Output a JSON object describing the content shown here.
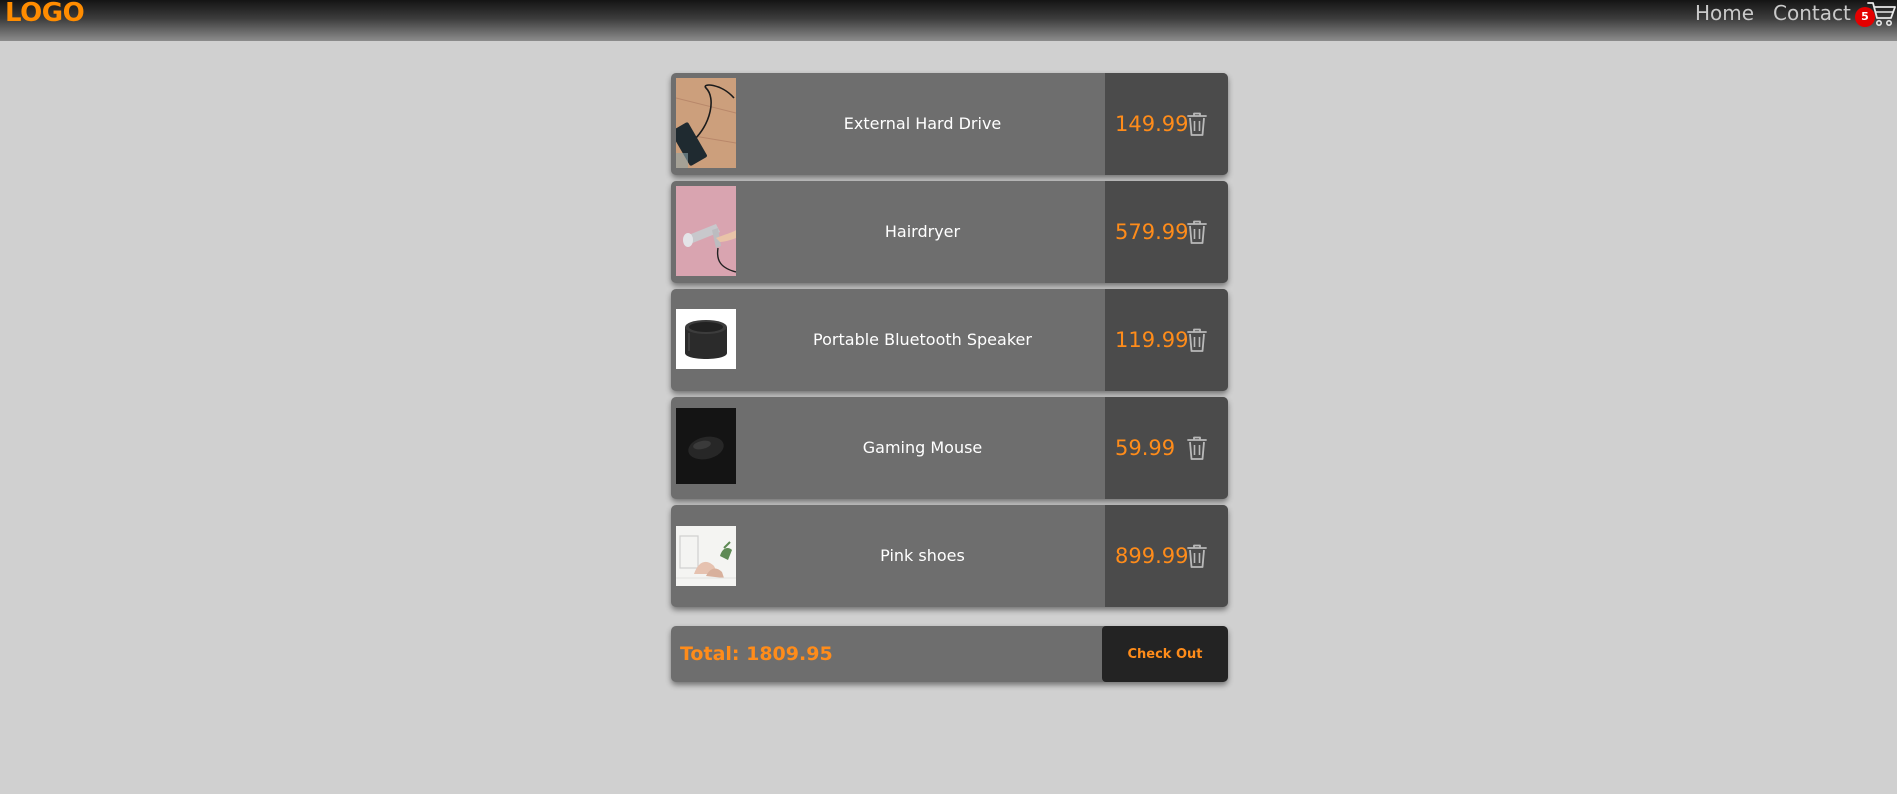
{
  "header": {
    "logo": "LOGO",
    "nav": [
      {
        "label": "Home"
      },
      {
        "label": "Contact"
      }
    ],
    "cart": {
      "icon": "cart-icon",
      "count": "5",
      "badge_color": "#e40000"
    }
  },
  "cart": {
    "items": [
      {
        "name": "External Hard Drive",
        "price": "149.99"
      },
      {
        "name": "Hairdryer",
        "price": "579.99"
      },
      {
        "name": "Portable Bluetooth Speaker",
        "price": "119.99"
      },
      {
        "name": "Gaming Mouse",
        "price": "59.99"
      },
      {
        "name": "Pink shoes",
        "price": "899.99"
      }
    ],
    "remove_icon": "trash-icon",
    "total_label": "Total: 1809.95",
    "checkout_label": "Check Out"
  },
  "colors": {
    "accent": "#ff8c1a",
    "background": "#d0d0d0",
    "item_bg": "#6e6e6e",
    "price_bg": "#4b4b4b",
    "checkout_bg": "#232323"
  }
}
